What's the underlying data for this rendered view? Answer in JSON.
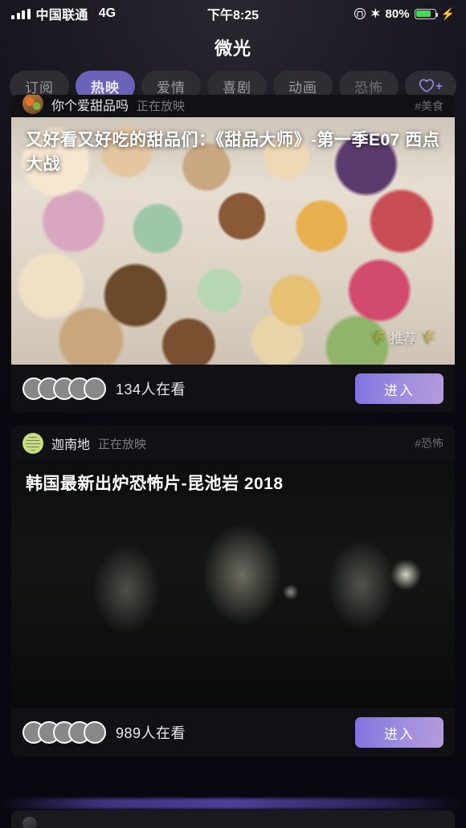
{
  "status_bar": {
    "carrier": "中国联通",
    "network": "4G",
    "time": "下午8:25",
    "battery_percent": "80%",
    "battery_level": 80,
    "icons": [
      "signal-bars-icon",
      "lock-rotation-icon",
      "bluetooth-icon",
      "battery-icon",
      "charging-bolt-icon"
    ]
  },
  "header": {
    "title": "微光"
  },
  "tabs": [
    {
      "label": "订阅",
      "active": false,
      "dim": false
    },
    {
      "label": "热映",
      "active": true,
      "dim": false
    },
    {
      "label": "爱情",
      "active": false,
      "dim": false
    },
    {
      "label": "喜剧",
      "active": false,
      "dim": false
    },
    {
      "label": "动画",
      "active": false,
      "dim": false
    },
    {
      "label": "恐怖",
      "active": false,
      "dim": true
    }
  ],
  "favorite_button": {
    "icon": "heart-plus-icon",
    "color": "#8f86ec"
  },
  "theme": {
    "accent": "#6a63b8",
    "button_gradient_start": "#8073e0",
    "button_gradient_end": "#b49bdd",
    "background": "#0b0910",
    "card_background": "#111014",
    "battery_green": "#47d85a"
  },
  "feed": [
    {
      "user": "你个爱甜品吗",
      "status": "正在放映",
      "tag": "#美食",
      "avatar": "food-avatar",
      "title": "",
      "clipped": true
    },
    {
      "user": "",
      "status": "",
      "tag": "",
      "title": "又好看又好吃的甜品们：《甜品大师》-第一季E07 西点大战",
      "badge": "推荐",
      "badge_icon": "wheat-icon",
      "watch_count": "134人在看",
      "enter_label": "进入",
      "avatar_count": 5
    },
    {
      "user": "迦南地",
      "status": "正在放映",
      "tag": "#恐怖",
      "avatar": "green-avatar",
      "title": "韩国最新出炉恐怖片-昆池岩 2018",
      "watch_count": "989人在看",
      "enter_label": "进入",
      "avatar_count": 5
    }
  ]
}
